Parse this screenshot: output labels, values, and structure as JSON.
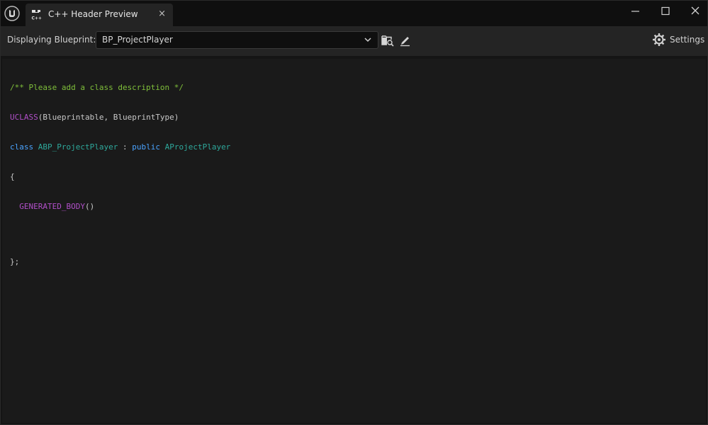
{
  "window": {
    "tab_title": "C++ Header Preview",
    "tab_close": "×"
  },
  "toolbar": {
    "display_label": "Displaying Blueprint:",
    "selected_blueprint": "BP_ProjectPlayer",
    "settings_label": "Settings"
  },
  "code": {
    "line1": {
      "comment": "/** Please add a class description */"
    },
    "line2": {
      "macro": "UCLASS",
      "args": "(Blueprintable, BlueprintType)"
    },
    "line3": {
      "keyword_class": "class",
      "class_name": "ABP_ProjectPlayer",
      "colon": " : ",
      "keyword_public": "public",
      "parent_class": "AProjectPlayer"
    },
    "line4": {
      "brace_open": "{"
    },
    "line5": {
      "macro": "GENERATED_BODY",
      "parens": "()"
    },
    "line6": {
      "brace_close": "};"
    }
  },
  "colors": {
    "comment": "#7fbf3a",
    "macro": "#b04fc8",
    "keyword": "#4aa3ff",
    "type": "#2ea89b",
    "plain": "#c8c8c8"
  },
  "icons": {
    "app": "unreal-engine-logo-icon",
    "tab": "cpp-header-icon",
    "browse": "folder-search-icon",
    "edit": "pencil-icon",
    "settings": "gear-icon",
    "dropdown": "chevron-down-icon"
  }
}
